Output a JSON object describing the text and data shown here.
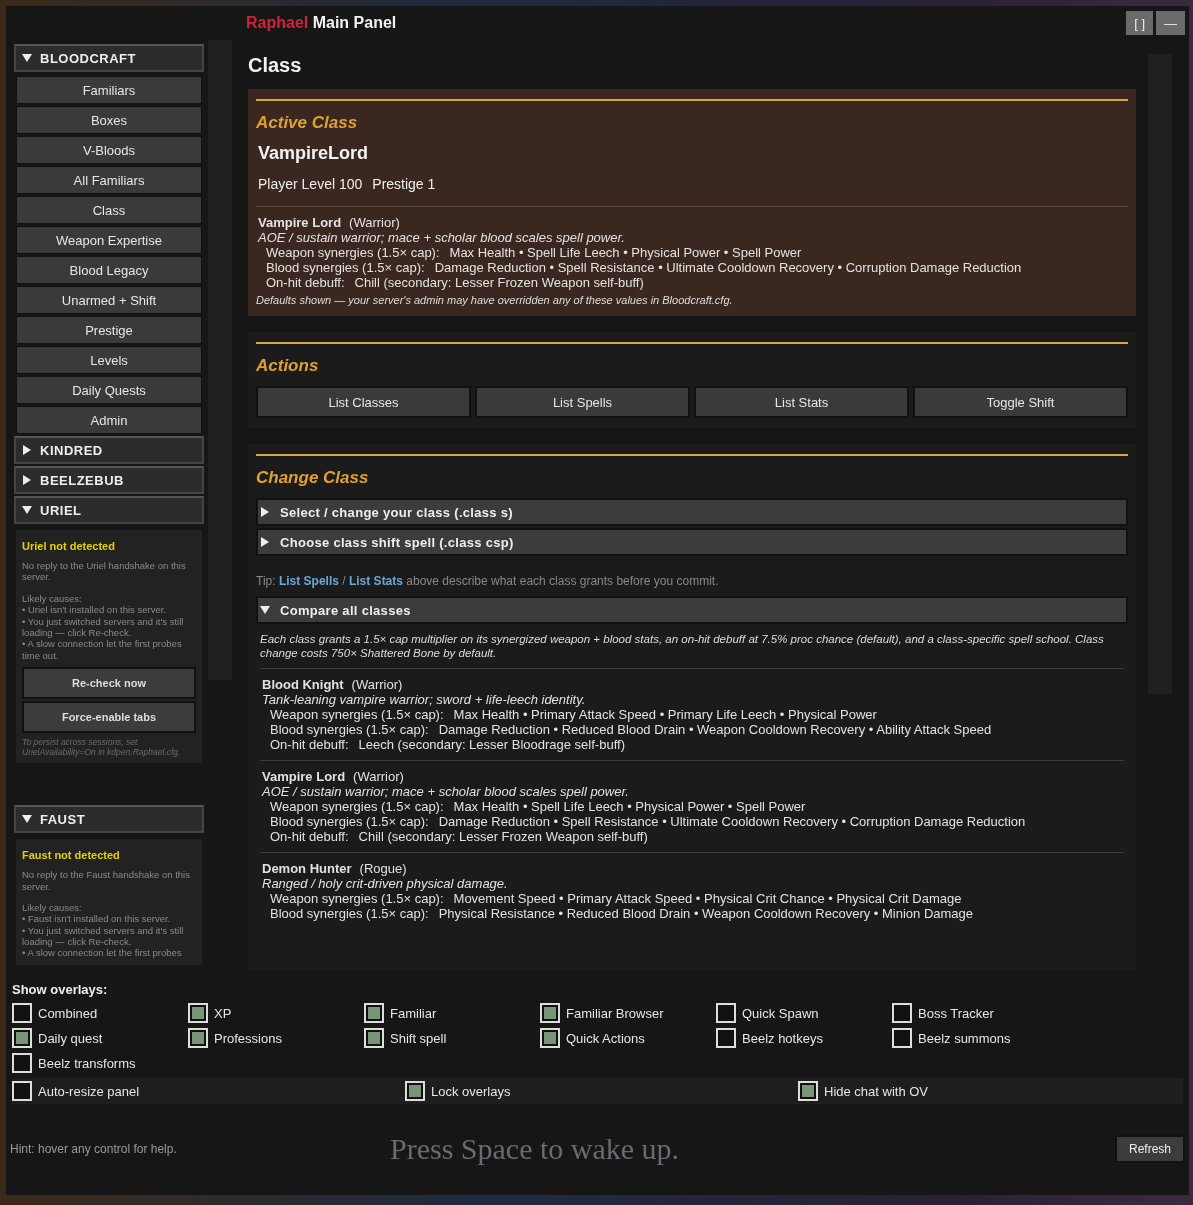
{
  "window": {
    "title_accent": "Raphael",
    "title": "Main Panel",
    "buttons": [
      {
        "label": "[ ]"
      },
      {
        "label": "—"
      }
    ]
  },
  "sidebar": [
    {
      "title": "BLOODCRAFT",
      "expanded": true,
      "items": [
        {
          "label": "Familiars"
        },
        {
          "label": "Boxes"
        },
        {
          "label": "V-Bloods"
        },
        {
          "label": "All Familiars"
        },
        {
          "label": "Class"
        },
        {
          "label": "Weapon Expertise"
        },
        {
          "label": "Blood Legacy"
        },
        {
          "label": "Unarmed + Shift"
        },
        {
          "label": "Prestige"
        },
        {
          "label": "Levels"
        },
        {
          "label": "Daily Quests"
        },
        {
          "label": "Admin"
        }
      ]
    },
    {
      "title": "KINDRED",
      "expanded": false
    },
    {
      "title": "BEELZEBUB",
      "expanded": false
    },
    {
      "title": "URIEL",
      "expanded": true,
      "notice": {
        "heading": "Uriel not detected",
        "body": "No reply to the Uriel handshake on this server.",
        "causes_title": "Likely causes:",
        "causes": [
          "• Uriel isn't installed on this server.",
          "• You just switched servers and it's still loading — click Re-check.",
          "• A slow connection let the first probes time out."
        ],
        "buttons": [
          "Re-check now",
          "Force-enable tabs"
        ],
        "footnote": "To persist across sessions, set UrielAvailability=On in kdpen.Raphael.cfg."
      }
    },
    {
      "title": "FAUST",
      "expanded": true,
      "notice": {
        "heading": "Faust not detected",
        "body": "No reply to the Faust handshake on this server.",
        "causes_title": "Likely causes:",
        "causes": [
          "• Faust isn't installed on this server.",
          "• You just switched servers and it's still loading — click Re-check.",
          "• A slow connection let the first probes"
        ]
      }
    }
  ],
  "page_title": "Class",
  "active_class": {
    "heading": "Active Class",
    "name": "VampireLord",
    "level": "Player Level 100",
    "prestige": "Prestige 1",
    "detail": {
      "name": "Vampire Lord",
      "role": "(Warrior)",
      "description": "AOE / sustain warrior; mace + scholar blood scales spell power.",
      "weapon_label": "Weapon synergies (1.5× cap):",
      "weapon": "Max Health  •  Spell Life Leech  •  Physical Power  •  Spell Power",
      "blood_label": "Blood synergies (1.5× cap):",
      "blood": "Damage Reduction  •  Spell Resistance  •  Ultimate Cooldown Recovery  •  Corruption Damage Reduction",
      "debuff_label": "On-hit debuff:",
      "debuff": "Chill  (secondary: Lesser Frozen Weapon self-buff)"
    },
    "note": "Defaults shown — your server's admin may have overridden any of these values in Bloodcraft.cfg."
  },
  "actions": {
    "heading": "Actions",
    "buttons": [
      "List Classes",
      "List Spells",
      "List Stats",
      "Toggle Shift"
    ]
  },
  "change_class": {
    "heading": "Change Class",
    "sections": [
      {
        "label": "Select / change your class (.class s)",
        "expanded": false
      },
      {
        "label": "Choose class shift spell (.class csp)",
        "expanded": false
      }
    ],
    "tip": "Tip: **List Spells** / **List Stats** above describe what each class grants before you commit.",
    "compare": {
      "label": "Compare all classes",
      "expanded": true,
      "intro": "Each class grants a 1.5× cap multiplier on its synergized weapon + blood stats, an on-hit debuff at 7.5% proc chance (default), and a class-specific spell school. Class change costs 750× Shattered Bone by default.",
      "classes": [
        {
          "name": "Blood Knight",
          "role": "(Warrior)",
          "description": "Tank-leaning vampire warrior; sword + life-leech identity.",
          "weapon_label": "Weapon synergies (1.5× cap):",
          "weapon": "Max Health  •  Primary Attack Speed  •  Primary Life Leech  •  Physical Power",
          "blood_label": "Blood synergies (1.5× cap):",
          "blood": "Damage Reduction  •  Reduced Blood Drain  •  Weapon Cooldown Recovery  •  Ability Attack Speed",
          "debuff_label": "On-hit debuff:",
          "debuff": "Leech  (secondary: Lesser Bloodrage self-buff)"
        },
        {
          "name": "Vampire Lord",
          "role": "(Warrior)",
          "description": "AOE / sustain warrior; mace + scholar blood scales spell power.",
          "weapon_label": "Weapon synergies (1.5× cap):",
          "weapon": "Max Health  •  Spell Life Leech  •  Physical Power  •  Spell Power",
          "blood_label": "Blood synergies (1.5× cap):",
          "blood": "Damage Reduction  •  Spell Resistance  •  Ultimate Cooldown Recovery  •  Corruption Damage Reduction",
          "debuff_label": "On-hit debuff:",
          "debuff": "Chill  (secondary: Lesser Frozen Weapon self-buff)"
        },
        {
          "name": "Demon Hunter",
          "role": "(Rogue)",
          "description": "Ranged / holy crit-driven physical damage.",
          "weapon_label": "Weapon synergies (1.5× cap):",
          "weapon": "Movement Speed  •  Primary Attack Speed  •  Physical Crit Chance  •  Physical Crit Damage",
          "blood_label": "Blood synergies (1.5× cap):",
          "blood": "Physical Resistance  •  Reduced Blood Drain  •  Weapon Cooldown Recovery  •  Minion Damage"
        }
      ]
    }
  },
  "overlays": {
    "title": "Show overlays:",
    "options": [
      {
        "label": "Combined",
        "checked": false
      },
      {
        "label": "XP",
        "checked": true
      },
      {
        "label": "Familiar",
        "checked": true
      },
      {
        "label": "Familiar Browser",
        "checked": true
      },
      {
        "label": "Quick Spawn",
        "checked": false
      },
      {
        "label": "Boss Tracker",
        "checked": false
      },
      {
        "label": "Daily quest",
        "checked": true
      },
      {
        "label": "Professions",
        "checked": true
      },
      {
        "label": "Shift spell",
        "checked": true
      },
      {
        "label": "Quick Actions",
        "checked": true
      },
      {
        "label": "Beelz hotkeys",
        "checked": false
      },
      {
        "label": "Beelz summons",
        "checked": false
      },
      {
        "label": "Beelz transforms",
        "checked": false
      }
    ],
    "settings": [
      {
        "label": "Auto-resize panel",
        "checked": false
      },
      {
        "label": "Lock overlays",
        "checked": true
      },
      {
        "label": "Hide chat with OV",
        "checked": true
      }
    ]
  },
  "status_bar": {
    "hint": "Hint: hover any control for help.",
    "backdrop_text": "Press Space to wake up.",
    "refresh": "Refresh"
  }
}
